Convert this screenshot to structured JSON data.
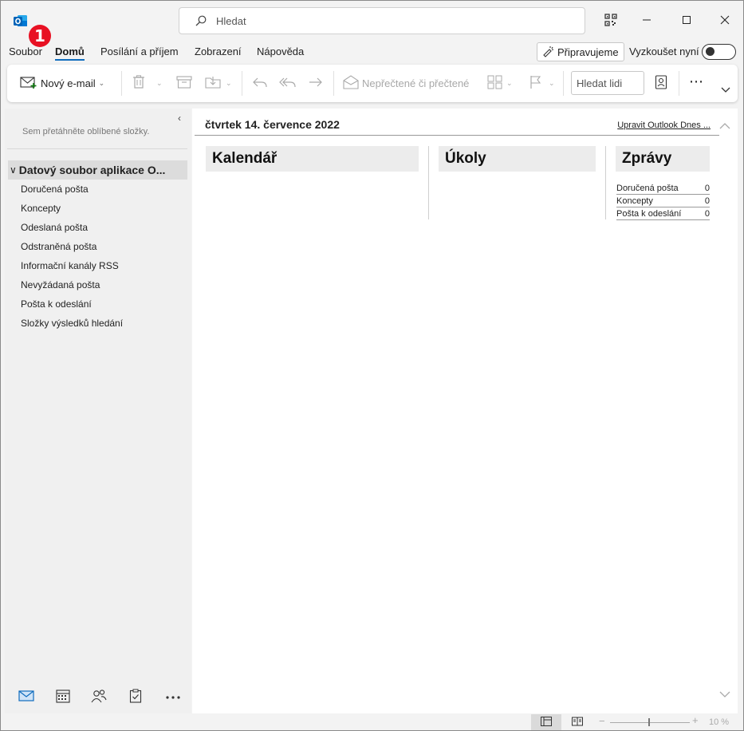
{
  "titlebar": {
    "search_placeholder": "Hledat",
    "badge": "1"
  },
  "menu": {
    "tabs": [
      "Soubor",
      "Domů",
      "Posílání a příjem",
      "Zobrazení",
      "Nápověda"
    ],
    "active_tab": "Domů",
    "coming_soon": "Připravujeme",
    "try_now": "Vyzkoušet nyní",
    "toggle_on": false
  },
  "ribbon": {
    "new_email": "Nový e-mail",
    "unread_read": "Nepřečtené či přečtené",
    "find_people_placeholder": "Hledat lidi",
    "more": "⋯"
  },
  "leftpane": {
    "collapse": "‹",
    "favorites_hint": "Sem přetáhněte oblíbené složky.",
    "account": "Datový soubor aplikace O...",
    "folders": [
      "Doručená pošta",
      "Koncepty",
      "Odeslaná pošta",
      "Odstraněná pošta",
      "Informační kanály RSS",
      "Nevyžádaná pošta",
      "Pošta k odeslání",
      "Složky výsledků hledání"
    ]
  },
  "main": {
    "date": "čtvrtek 14. července 2022",
    "customize": "Upravit Outlook Dnes ...",
    "columns": {
      "calendar": "Kalendář",
      "tasks": "Úkoly",
      "messages": "Zprávy"
    },
    "message_rows": [
      {
        "label": "Doručená pošta",
        "count": "0"
      },
      {
        "label": "Koncepty",
        "count": "0"
      },
      {
        "label": "Pošta k odeslání",
        "count": "0"
      }
    ]
  },
  "status": {
    "zoom": "10 %",
    "zoom_minus": "−",
    "zoom_plus": "+"
  },
  "colors": {
    "accent": "#0f6cbd",
    "badge": "#e81123"
  }
}
